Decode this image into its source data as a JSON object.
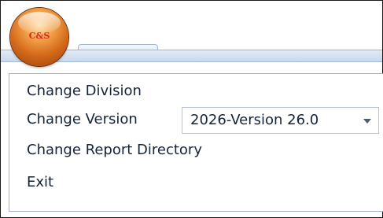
{
  "app": {
    "orb_label": "C&S",
    "orb_icon": "app-orb-icon"
  },
  "menu": {
    "items": [
      {
        "label": "Change Division"
      },
      {
        "label": "Change Version"
      },
      {
        "label": "Change Report Directory"
      },
      {
        "label": "Exit"
      }
    ],
    "version_select": {
      "selected": "2026-Version 26.0",
      "arrow_icon": "chevron-down-icon"
    }
  },
  "colors": {
    "orb": "#e07a2a",
    "orb_text": "#d42a1f",
    "ribbon": "#c9d8ec",
    "menu_text": "#15243b"
  }
}
